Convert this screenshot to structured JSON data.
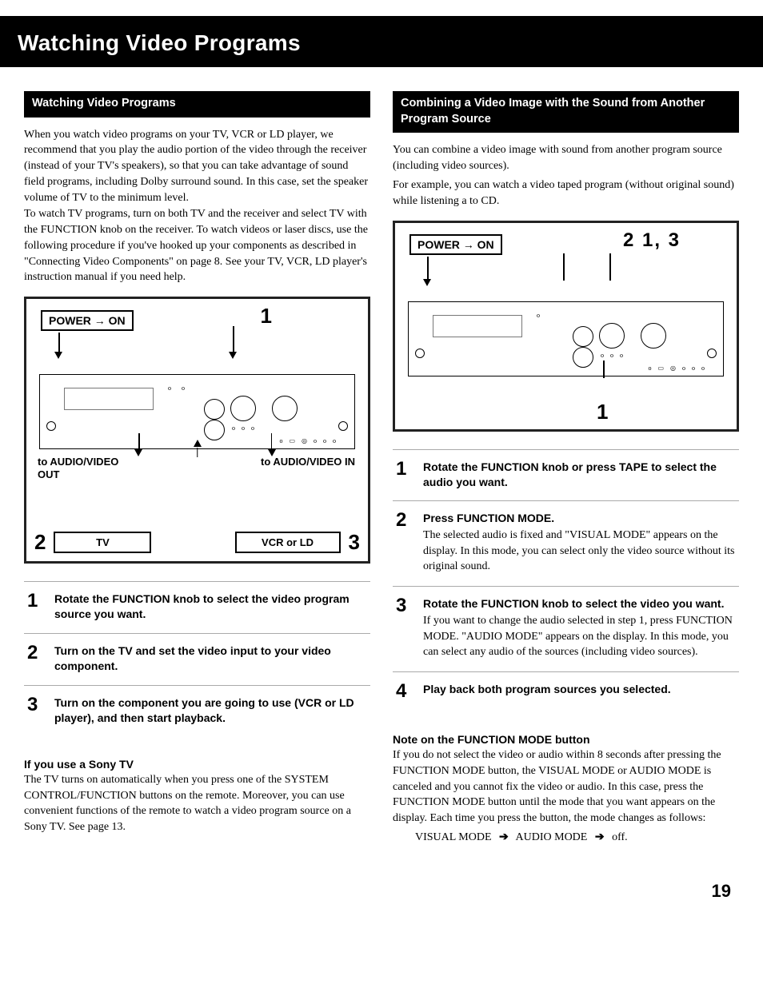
{
  "masthead": "Watching Video Programs",
  "left": {
    "heading": "Watching Video Programs",
    "intro": "When you watch video programs on your TV, VCR or LD player, we recommend that you play the audio portion of the video through the receiver (instead of your TV's speakers), so that you can take advantage of sound field programs, including Dolby surround sound. In this case, set the speaker volume of TV to the minimum level.\nTo watch TV programs, turn on both TV and the receiver and select TV with the FUNCTION knob on the receiver. To watch videos or laser discs, use the following procedure if you've hooked up your components as described in \"Connecting Video Components\" on page 8. See your TV, VCR, LD player's instruction manual if you need help.",
    "diagram": {
      "power": "POWER → ON",
      "top_number": "1",
      "out_label": "to AUDIO/VIDEO OUT",
      "in_label": "to AUDIO/VIDEO IN",
      "bottom_left_num": "2",
      "tv_box": "TV",
      "vcr_box": "VCR or LD",
      "bottom_right_num": "3"
    },
    "steps": [
      {
        "num": "1",
        "title": "Rotate the FUNCTION knob to select the video program source you want."
      },
      {
        "num": "2",
        "title": "Turn on the TV and set the video input to your video component."
      },
      {
        "num": "3",
        "title": "Turn on the component you are going to use (VCR or LD player), and then start playback."
      }
    ],
    "sony_heading": "If you use a Sony TV",
    "sony_body": "The TV turns on automatically when you press one of the SYSTEM CONTROL/FUNCTION buttons on the remote. Moreover, you can use convenient functions of the remote to watch a video program source on a Sony TV. See page 13."
  },
  "right": {
    "heading": "Combining a Video Image with the Sound from Another Program Source",
    "intro1": "You can combine a video image with sound from another program source (including video sources).",
    "intro2": "For example, you can watch a video taped program (without original sound) while listening a to CD.",
    "diagram": {
      "power": "POWER → ON",
      "top_numbers": "2  1, 3",
      "bottom_number": "1"
    },
    "steps": [
      {
        "num": "1",
        "title": "Rotate the FUNCTION knob or press TAPE to select the audio you want."
      },
      {
        "num": "2",
        "title": "Press FUNCTION MODE.",
        "detail": "The selected audio is fixed and \"VISUAL MODE\" appears on the display. In this mode, you can select only the video source without its original sound."
      },
      {
        "num": "3",
        "title": "Rotate the FUNCTION knob to select the video you want.",
        "detail": "If you want to change the audio selected in step 1, press FUNCTION MODE. \"AUDIO MODE\" appears on the display. In this mode, you can select any audio of the sources (including video sources)."
      },
      {
        "num": "4",
        "title": "Play back both program sources you selected."
      }
    ],
    "note_heading": "Note on the FUNCTION MODE button",
    "note_body": "If you do not select the video or audio within 8 seconds after pressing the FUNCTION MODE button, the VISUAL MODE or AUDIO MODE is canceled and you cannot fix the video or audio. In this case, press the FUNCTION MODE button until the mode that you want appears on the display. Each time you press the button, the mode changes as follows:",
    "mode_sequence": {
      "a": "VISUAL MODE",
      "b": "AUDIO MODE",
      "c": "off."
    }
  },
  "page_number": "19"
}
